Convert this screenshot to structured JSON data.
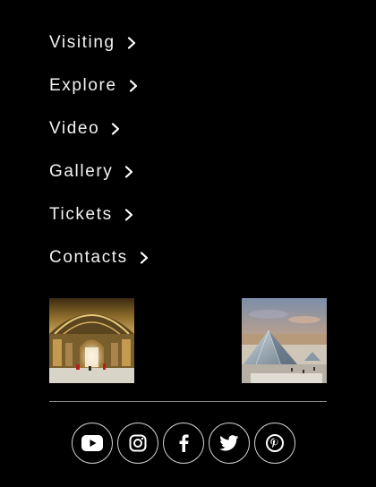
{
  "nav": {
    "items": [
      {
        "label": "Visiting",
        "icon": "chevron-right-icon"
      },
      {
        "label": "Explore",
        "icon": "chevron-right-icon"
      },
      {
        "label": "Video",
        "icon": "chevron-right-icon"
      },
      {
        "label": "Gallery",
        "icon": "chevron-right-icon"
      },
      {
        "label": "Tickets",
        "icon": "chevron-right-icon"
      },
      {
        "label": "Contacts",
        "icon": "chevron-right-icon"
      }
    ]
  },
  "gallery": {
    "thumbnails": [
      {
        "subject": "ornate-gilded-hall-interior"
      },
      {
        "subject": "glass-pyramid-courtyard-sunset"
      }
    ]
  },
  "social": {
    "icons": [
      "youtube-icon",
      "instagram-icon",
      "facebook-icon",
      "twitter-icon",
      "pinterest-icon"
    ]
  },
  "colors": {
    "background": "#000000",
    "text": "#f2f2f2",
    "divider": "#8a8a8a",
    "icon_border": "#cfcfcf"
  }
}
